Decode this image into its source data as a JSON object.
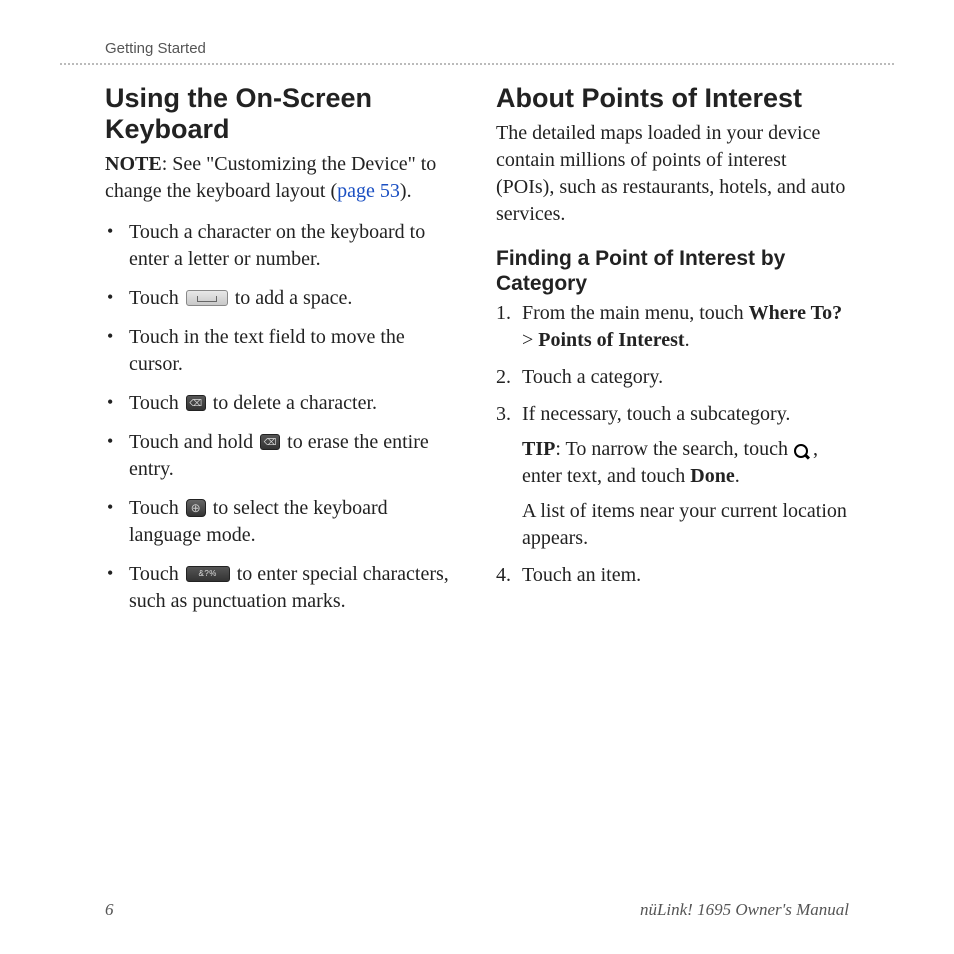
{
  "header": "Getting Started",
  "left": {
    "heading": "Using the On-Screen Keyboard",
    "note_label": "NOTE",
    "note_prefix_a": ": See \"Customizing the Device\" to change the keyboard layout (",
    "note_link": "page 53",
    "note_suffix": ").",
    "bullets": {
      "b1": "Touch a character on the keyboard to enter a letter or number.",
      "b2a": "Touch ",
      "b2b": " to add a space.",
      "b3": "Touch in the text field to move the cursor.",
      "b4a": "Touch ",
      "b4b": " to delete a character.",
      "b5a": "Touch and hold ",
      "b5b": " to erase the entire entry.",
      "b6a": "Touch ",
      "b6b": " to select the keyboard language mode.",
      "b7a": "Touch ",
      "b7b": " to enter special characters, such as punctuation marks."
    }
  },
  "right": {
    "heading": "About Points of Interest",
    "intro": "The detailed maps loaded in your device contain millions of points of interest (POIs), such as restaurants, hotels, and auto services.",
    "subheading": "Finding a Point of Interest by Category",
    "step1a": "From the main menu, touch ",
    "step1b": "Where To?",
    "step1c": " > ",
    "step1d": "Points of Interest",
    "step1e": ".",
    "step2": "Touch a category.",
    "step3": "If necessary, touch a subcategory.",
    "tip_label": "TIP",
    "tip_a": ": To narrow the search, touch ",
    "tip_b": ", enter text, and touch ",
    "tip_done": "Done",
    "tip_end": ".",
    "step3_result": "A list of items near your current location appears.",
    "step4": "Touch an item."
  },
  "footer": {
    "page": "6",
    "title": "nüLink! 1695 Owner's Manual"
  }
}
